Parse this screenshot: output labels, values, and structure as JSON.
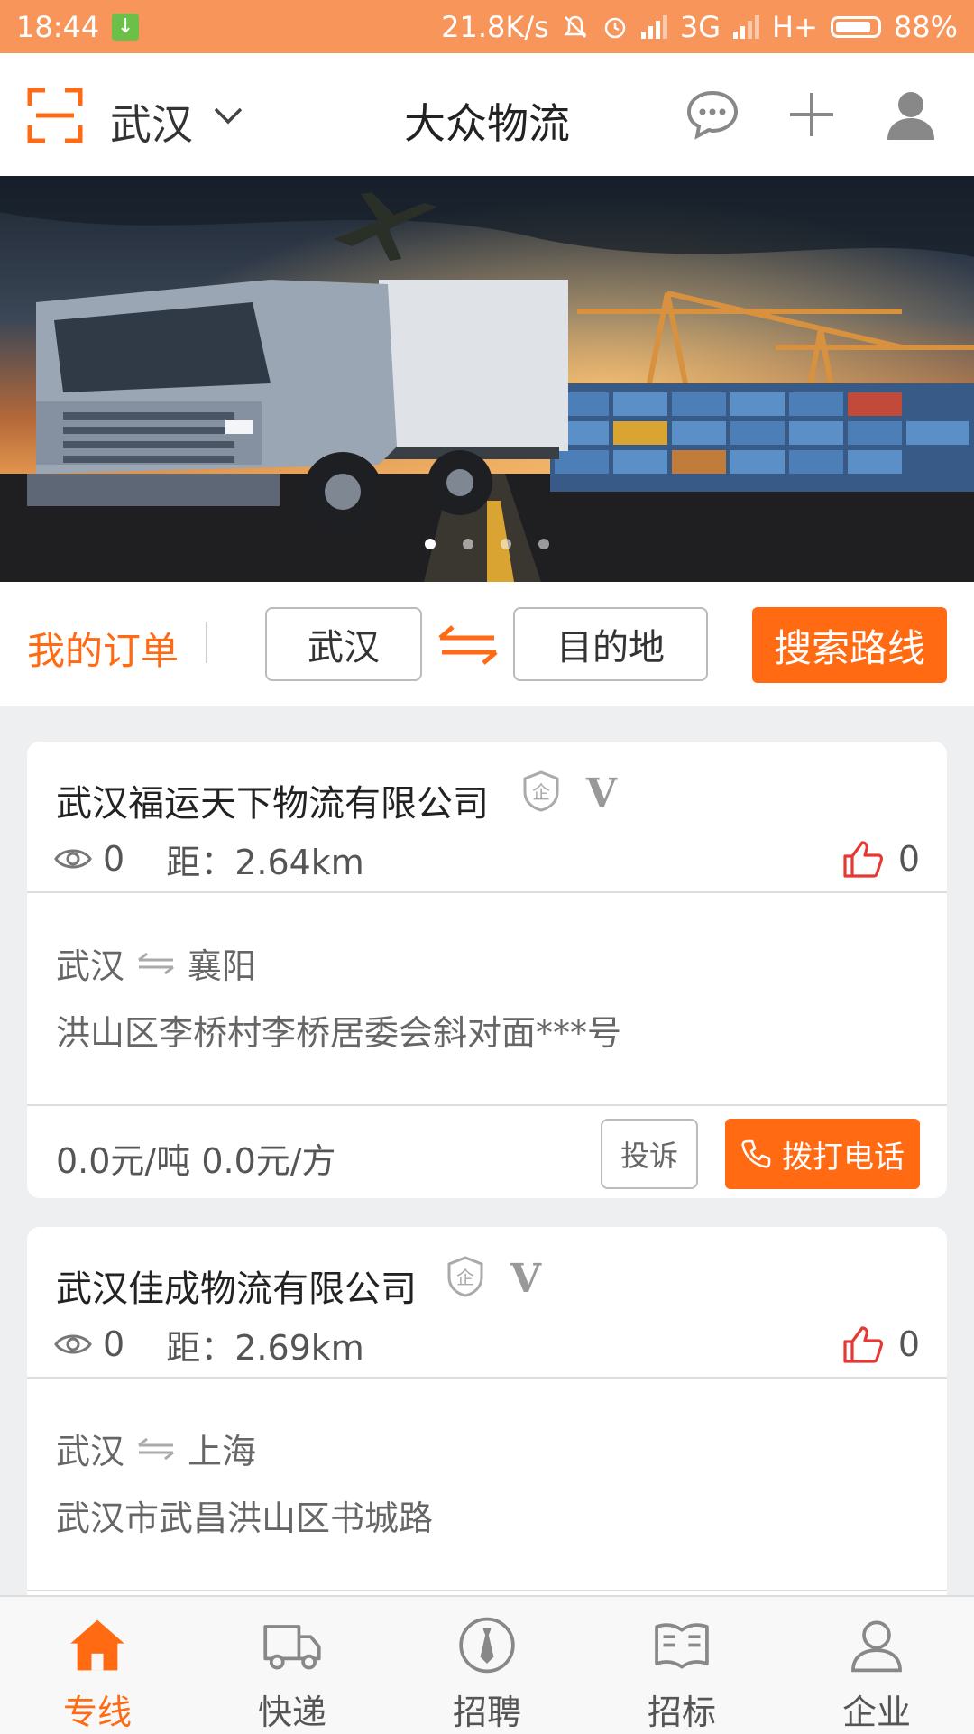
{
  "status_bar": {
    "time": "18:44",
    "speed": "21.8K/s",
    "network1": "3G",
    "network2": "H+",
    "battery": "88%",
    "battery_level": 0.88
  },
  "header": {
    "city": "武汉",
    "title": "大众物流",
    "icons": [
      "scan-icon",
      "chat-icon",
      "plus-icon",
      "user-icon"
    ]
  },
  "banner": {
    "slides": 4,
    "active_slide": 1
  },
  "search": {
    "my_orders": "我的订单",
    "origin": "武汉",
    "destination": "目的地",
    "button": "搜索路线"
  },
  "cards": [
    {
      "company": "武汉福运天下物流有限公司",
      "views": "0",
      "distance": "距：2.64km",
      "likes": "0",
      "from": "武汉",
      "to": "襄阳",
      "address": "洪山区李桥村李桥居委会斜对面***号",
      "prices": "0.0元/吨  0.0元/方",
      "complain": "投诉",
      "call": "拨打电话"
    },
    {
      "company": "武汉佳成物流有限公司",
      "views": "0",
      "distance": "距：2.69km",
      "likes": "0",
      "from": "武汉",
      "to": "上海",
      "address": "武汉市武昌洪山区书城路"
    }
  ],
  "badges": {
    "enterprise": "企",
    "verified": "V"
  },
  "bottom_nav": [
    {
      "label": "专线",
      "icon": "home-icon",
      "active": true
    },
    {
      "label": "快递",
      "icon": "truck-icon",
      "active": false
    },
    {
      "label": "招聘",
      "icon": "tie-icon",
      "active": false
    },
    {
      "label": "招标",
      "icon": "book-icon",
      "active": false
    },
    {
      "label": "企业",
      "icon": "person-icon",
      "active": false
    }
  ],
  "colors": {
    "accent": "#ff6a13",
    "status_bar": "#f7955a",
    "like": "#e53935"
  }
}
